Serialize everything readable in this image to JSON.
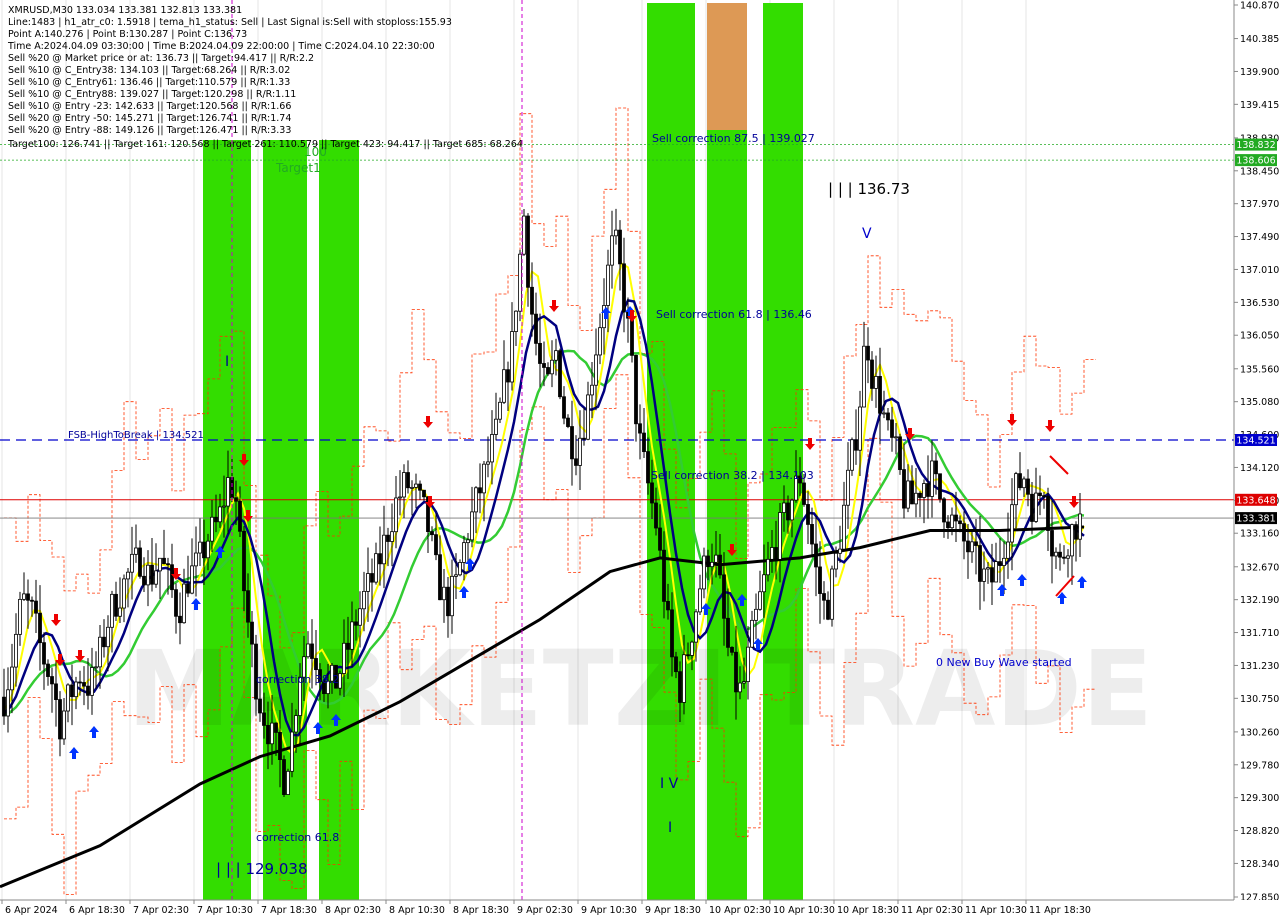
{
  "header": {
    "lines": [
      "XMRUSD,M30  133.034 133.381 132.813 133.381",
      "Line:1483  | h1_atr_c0: 1.5918  | tema_h1_status: Sell  | Last Signal is:Sell with stoploss:155.93",
      "Point A:140.276  | Point B:130.287  | Point C:136.73",
      "Time A:2024.04.09 03:30:00  | Time B:2024.04.09 22:00:00  | Time C:2024.04.10 22:30:00",
      "Sell %20 @ Market price or at: 136.73  || Target:94.417  || R/R:2.2",
      "Sell %10 @ C_Entry38: 134.103  || Target:68.264  || R/R:3.02",
      "Sell %10 @ C_Entry61: 136.46  || Target:110.579  || R/R:1.33",
      "Sell %10 @ C_Entry88: 139.027  || Target:120.298  || R/R:1.11",
      "Sell %10 @ Entry -23: 142.633  || Target:120.568  || R/R:1.66",
      "Sell %20 @ Entry -50: 145.271  || Target:126.741  || R/R:1.74",
      "Sell %20 @ Entry -88: 149.126  || Target:126.471  || R/R:3.33"
    ],
    "targets_line": "Target100: 126.741  || Target 161: 120.568  || Target 261: 110.579  || Target 423: 94.417  || Target 685: 68.264"
  },
  "annotations": {
    "sell_correction_875": "Sell correction 87.5 | 139.027",
    "sell_correction_618": "Sell correction 61.8 | 136.46",
    "sell_correction_382": "Sell correction 38.2 | 134.103",
    "point_c": "| | | 136.73",
    "point_b": "| | | 129.038",
    "wave_v": "V",
    "wave_iv": "I V",
    "wave_i": "I",
    "wave_i_small": "I",
    "correction_382": "correction 38.2",
    "correction_618": "correction 61.8",
    "target1": "Target1",
    "label_100": "100",
    "fsb_label": "FSB-HighToBreak  | 134.521",
    "new_buy_wave": "0 New Buy Wave started",
    "watermark": "MARKETZI TRADE"
  },
  "price_labels": {
    "fsb": "134.521",
    "red_line": "133.648",
    "current": "133.381",
    "green_1": "138.832",
    "green_2": "138.606"
  },
  "colors": {
    "background": "#ffffff",
    "bull_candle": "#ffffff",
    "bear_candle": "#000000",
    "green_zone": "#33dd00",
    "orange_zone": "#dd9955",
    "fsb_line": "#0000cc",
    "red_line": "#dd0000",
    "current_price": "#000000",
    "ma_long": "#000000",
    "ma_navy": "#000080",
    "ma_green": "#33cc33",
    "ma_yellow": "#ffff00",
    "envelope": "#ff3300",
    "arrow_up": "#0033ff",
    "arrow_down": "#ee0000",
    "annotation_text": "#000099",
    "green_label": "#22aa22"
  },
  "chart_data": {
    "type": "candlestick",
    "symbol": "XMRUSD",
    "timeframe": "M30",
    "y_ticks": [
      140.87,
      140.38,
      139.9,
      139.42,
      138.93,
      138.45,
      137.97,
      137.49,
      137.01,
      136.53,
      136.05,
      135.56,
      135.08,
      134.6,
      134.12,
      133.64,
      133.16,
      132.67,
      132.19,
      131.71,
      131.23,
      130.75,
      130.26,
      129.78,
      129.3,
      128.82,
      128.34,
      127.85
    ],
    "y_tick_labels": [
      "140.870",
      "140.385",
      "139.900",
      "139.415",
      "138.930",
      "138.450",
      "137.970",
      "137.490",
      "137.010",
      "136.530",
      "136.050",
      "135.560",
      "135.080",
      "134.600",
      "134.120",
      "133.640",
      "133.160",
      "132.670",
      "132.190",
      "131.710",
      "131.230",
      "130.750",
      "130.260",
      "129.780",
      "129.300",
      "128.820",
      "128.340",
      "127.850"
    ],
    "x_labels": [
      "6 Apr 2024",
      "6 Apr 18:30",
      "7 Apr 02:30",
      "7 Apr 10:30",
      "7 Apr 18:30",
      "8 Apr 02:30",
      "8 Apr 10:30",
      "8 Apr 18:30",
      "9 Apr 02:30",
      "9 Apr 10:30",
      "9 Apr 18:30",
      "10 Apr 02:30",
      "10 Apr 10:30",
      "10 Apr 18:30",
      "11 Apr 02:30",
      "11 Apr 10:30",
      "11 Apr 18:30"
    ],
    "ylim": [
      127.85,
      140.87
    ],
    "levels": {
      "fsb_high_to_break": 134.521,
      "red_line": 133.648,
      "current": 133.381,
      "green_1": 138.832,
      "green_2": 138.606
    },
    "close_path": [
      [
        0,
        130.5
      ],
      [
        12,
        131.3
      ],
      [
        22,
        132.2
      ],
      [
        32,
        132.0
      ],
      [
        42,
        131.4
      ],
      [
        52,
        131.0
      ],
      [
        60,
        130.4
      ],
      [
        70,
        130.8
      ],
      [
        80,
        131.1
      ],
      [
        90,
        130.9
      ],
      [
        100,
        131.4
      ],
      [
        110,
        132.0
      ],
      [
        120,
        132.3
      ],
      [
        130,
        132.6
      ],
      [
        140,
        132.8
      ],
      [
        150,
        132.5
      ],
      [
        160,
        132.8
      ],
      [
        170,
        132.4
      ],
      [
        178,
        132.0
      ],
      [
        188,
        132.5
      ],
      [
        198,
        132.7
      ],
      [
        208,
        133.1
      ],
      [
        218,
        133.3
      ],
      [
        228,
        133.9
      ],
      [
        235,
        133.8
      ],
      [
        242,
        132.6
      ],
      [
        250,
        131.6
      ],
      [
        258,
        130.8
      ],
      [
        266,
        130.4
      ],
      [
        276,
        130.0
      ],
      [
        284,
        129.6
      ],
      [
        292,
        130.2
      ],
      [
        300,
        131.2
      ],
      [
        308,
        131.6
      ],
      [
        318,
        131.3
      ],
      [
        326,
        130.9
      ],
      [
        336,
        131.0
      ],
      [
        346,
        131.4
      ],
      [
        356,
        131.9
      ],
      [
        366,
        132.3
      ],
      [
        376,
        132.6
      ],
      [
        386,
        133.1
      ],
      [
        396,
        133.6
      ],
      [
        406,
        133.9
      ],
      [
        416,
        133.7
      ],
      [
        426,
        133.4
      ],
      [
        436,
        132.6
      ],
      [
        446,
        132.1
      ],
      [
        456,
        132.4
      ],
      [
        466,
        133.1
      ],
      [
        476,
        133.6
      ],
      [
        486,
        134.1
      ],
      [
        496,
        134.6
      ],
      [
        504,
        135.3
      ],
      [
        512,
        135.9
      ],
      [
        518,
        136.9
      ],
      [
        524,
        137.8
      ],
      [
        530,
        136.6
      ],
      [
        538,
        135.7
      ],
      [
        546,
        135.2
      ],
      [
        556,
        135.8
      ],
      [
        566,
        134.7
      ],
      [
        576,
        134.4
      ],
      [
        586,
        134.9
      ],
      [
        596,
        135.9
      ],
      [
        606,
        136.8
      ],
      [
        614,
        137.5
      ],
      [
        622,
        136.8
      ],
      [
        630,
        135.9
      ],
      [
        638,
        134.6
      ],
      [
        646,
        134.0
      ],
      [
        656,
        133.3
      ],
      [
        664,
        132.3
      ],
      [
        672,
        131.3
      ],
      [
        680,
        130.9
      ],
      [
        690,
        131.6
      ],
      [
        700,
        132.4
      ],
      [
        710,
        133.0
      ],
      [
        718,
        132.6
      ],
      [
        726,
        131.6
      ],
      [
        734,
        131.0
      ],
      [
        742,
        130.8
      ],
      [
        750,
        131.5
      ],
      [
        760,
        132.2
      ],
      [
        770,
        132.8
      ],
      [
        780,
        133.2
      ],
      [
        790,
        133.6
      ],
      [
        800,
        134.0
      ],
      [
        810,
        133.2
      ],
      [
        818,
        132.4
      ],
      [
        826,
        132.0
      ],
      [
        834,
        132.6
      ],
      [
        842,
        133.3
      ],
      [
        850,
        134.1
      ],
      [
        858,
        134.8
      ],
      [
        866,
        136.1
      ],
      [
        872,
        135.5
      ],
      [
        880,
        135.1
      ],
      [
        888,
        134.6
      ],
      [
        896,
        134.3
      ],
      [
        904,
        133.7
      ],
      [
        912,
        133.6
      ],
      [
        922,
        133.9
      ],
      [
        932,
        134.0
      ],
      [
        942,
        133.6
      ],
      [
        950,
        133.4
      ],
      [
        960,
        133.1
      ],
      [
        970,
        132.9
      ],
      [
        980,
        132.6
      ],
      [
        990,
        132.4
      ],
      [
        1000,
        132.8
      ],
      [
        1008,
        133.3
      ],
      [
        1016,
        133.8
      ],
      [
        1024,
        134.0
      ],
      [
        1034,
        133.5
      ],
      [
        1044,
        133.9
      ],
      [
        1052,
        133.0
      ],
      [
        1060,
        132.7
      ],
      [
        1068,
        133.1
      ],
      [
        1076,
        133.3
      ],
      [
        1084,
        133.38
      ]
    ]
  }
}
